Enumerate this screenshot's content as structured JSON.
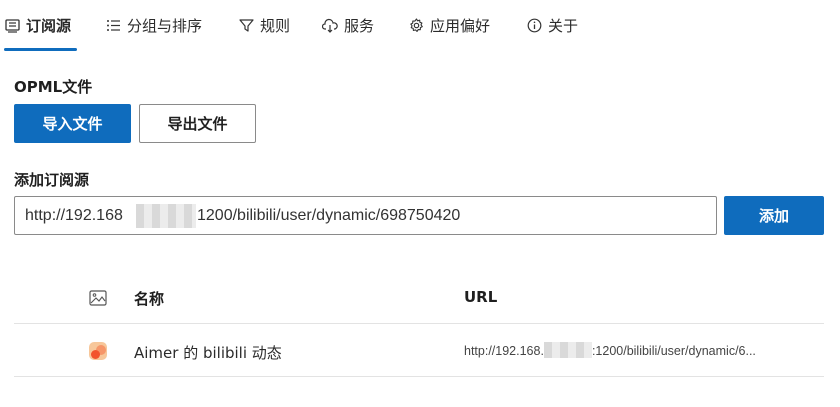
{
  "tabs": [
    {
      "label": "订阅源",
      "icon": "feed-list-icon",
      "active": true
    },
    {
      "label": "分组与排序",
      "icon": "bullet-list-icon",
      "active": false
    },
    {
      "label": "规则",
      "icon": "filter-icon",
      "active": false
    },
    {
      "label": "服务",
      "icon": "cloud-sync-icon",
      "active": false
    },
    {
      "label": "应用偏好",
      "icon": "gear-icon",
      "active": false
    },
    {
      "label": "关于",
      "icon": "info-icon",
      "active": false
    }
  ],
  "opml": {
    "heading": "OPML文件",
    "import_label": "导入文件",
    "export_label": "导出文件"
  },
  "add_source": {
    "heading": "添加订阅源",
    "input_value_prefix": "http://192.168",
    "input_value_suffix": "1200/bilibili/user/dynamic/698750420",
    "add_label": "添加"
  },
  "table": {
    "columns": {
      "icon": "image-icon",
      "name": "名称",
      "url": "URL"
    },
    "rows": [
      {
        "icon": "feed-favicon-icon",
        "name": "Aimer 的 bilibili 动态",
        "url_prefix": "http://192.168.",
        "url_suffix": ":1200/bilibili/user/dynamic/6..."
      }
    ]
  },
  "colors": {
    "accent": "#0f6cbd"
  }
}
